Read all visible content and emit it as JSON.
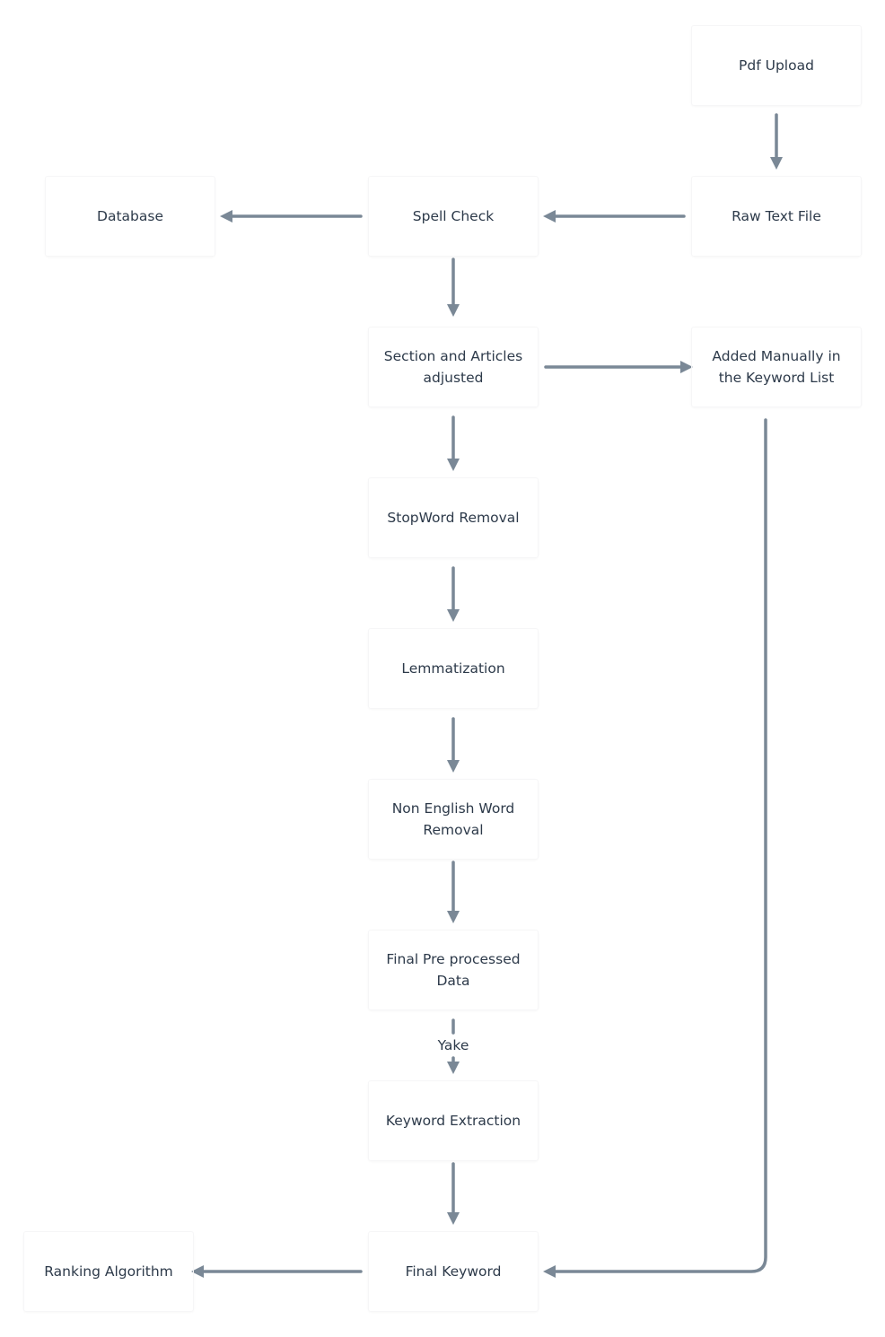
{
  "nodes": {
    "pdf_upload": "Pdf Upload",
    "raw_text": "Raw Text File",
    "spell_check": "Spell Check",
    "database": "Database",
    "section_articles": "Section and Articles\nadjusted",
    "added_manually": "Added Manually in\nthe Keyword List",
    "stopword": "StopWord Removal",
    "lemmatization": "Lemmatization",
    "non_english": "Non English Word\nRemoval",
    "final_preprocessed": "Final Pre processed\nData",
    "keyword_extraction": "Keyword Extraction",
    "final_keyword": "Final Keyword",
    "ranking": "Ranking Algorithm"
  },
  "edges": {
    "yake_label": "Yake"
  },
  "colors": {
    "arrow": "#7a8896",
    "text": "#2d3a4a"
  }
}
